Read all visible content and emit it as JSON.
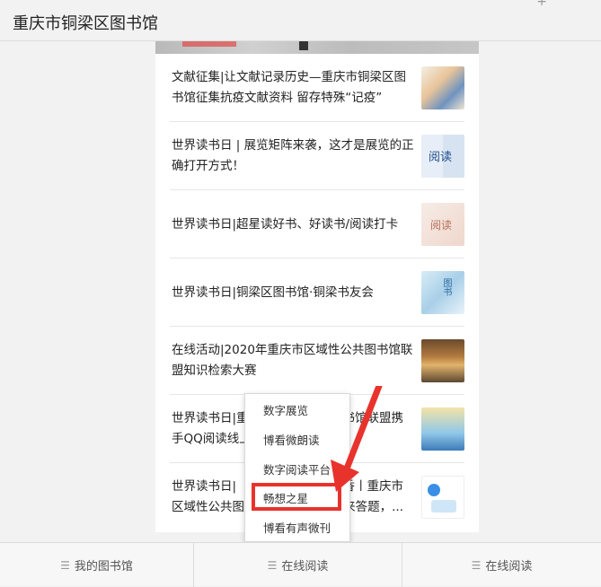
{
  "header": {
    "title": "重庆市铜梁区图书馆",
    "plus_icon": "+"
  },
  "articles": [
    {
      "title": "文献征集|让文献记录历史—重庆市铜梁区图书馆征集抗疫文献资料 留存特殊“记疫”",
      "thumb_icon": "poster-thumbnail"
    },
    {
      "title": "世界读书日 | 展览矩阵来袭，这才是展览的正确打开方式！",
      "thumb_icon": "book-cover-thumbnail",
      "thumb_text": "阅读"
    },
    {
      "title": "世界读书日|超星读好书、好读书/阅读打卡",
      "thumb_icon": "reading-thumbnail",
      "thumb_text": "阅读"
    },
    {
      "title": "世界读书日|铜梁区图书馆·铜梁书友会",
      "thumb_icon": "book-club-thumbnail",
      "thumb_text": "图书"
    },
    {
      "title": "在线活动|2020年重庆市区域性公共图书馆联盟知识检索大赛",
      "thumb_icon": "building-thumbnail"
    },
    {
      "title": "世界读书日|重庆市区域性公共图书馆联盟携手QQ阅读线上活动",
      "thumb_icon": "illustration-thumbnail"
    },
    {
      "title": "世界读书日|聆听书香丨重庆市区域性公共图书馆联盟来答题，...",
      "thumb_icon": "logo-thumbnail"
    }
  ],
  "visible_text_fragments": {
    "article6_line1_left": "世界读书日|重",
    "article6_line1_right": "书馆联盟携",
    "article6_line2_left": "手QQ阅读线上",
    "article7_line1_left": "世界读书日|",
    "article7_line1_right": "书香丨重庆市",
    "article7_line2_left": "区域性公共图",
    "article7_line2_right": "来答题，..."
  },
  "popup_menu": {
    "items": [
      {
        "label": "数字展览"
      },
      {
        "label": "博看微朗读"
      },
      {
        "label": "数字阅读平台"
      },
      {
        "label": "畅想之星",
        "highlighted": true
      },
      {
        "label": "博看有声微刊"
      }
    ]
  },
  "bottom_nav": {
    "tabs": [
      {
        "label": "我的图书馆",
        "icon": "menu-icon"
      },
      {
        "label": "在线阅读",
        "icon": "menu-icon"
      },
      {
        "label": "在线阅读",
        "icon": "menu-icon"
      }
    ]
  },
  "colors": {
    "annotation_red": "#e8332d",
    "background": "#f2f2f2"
  }
}
